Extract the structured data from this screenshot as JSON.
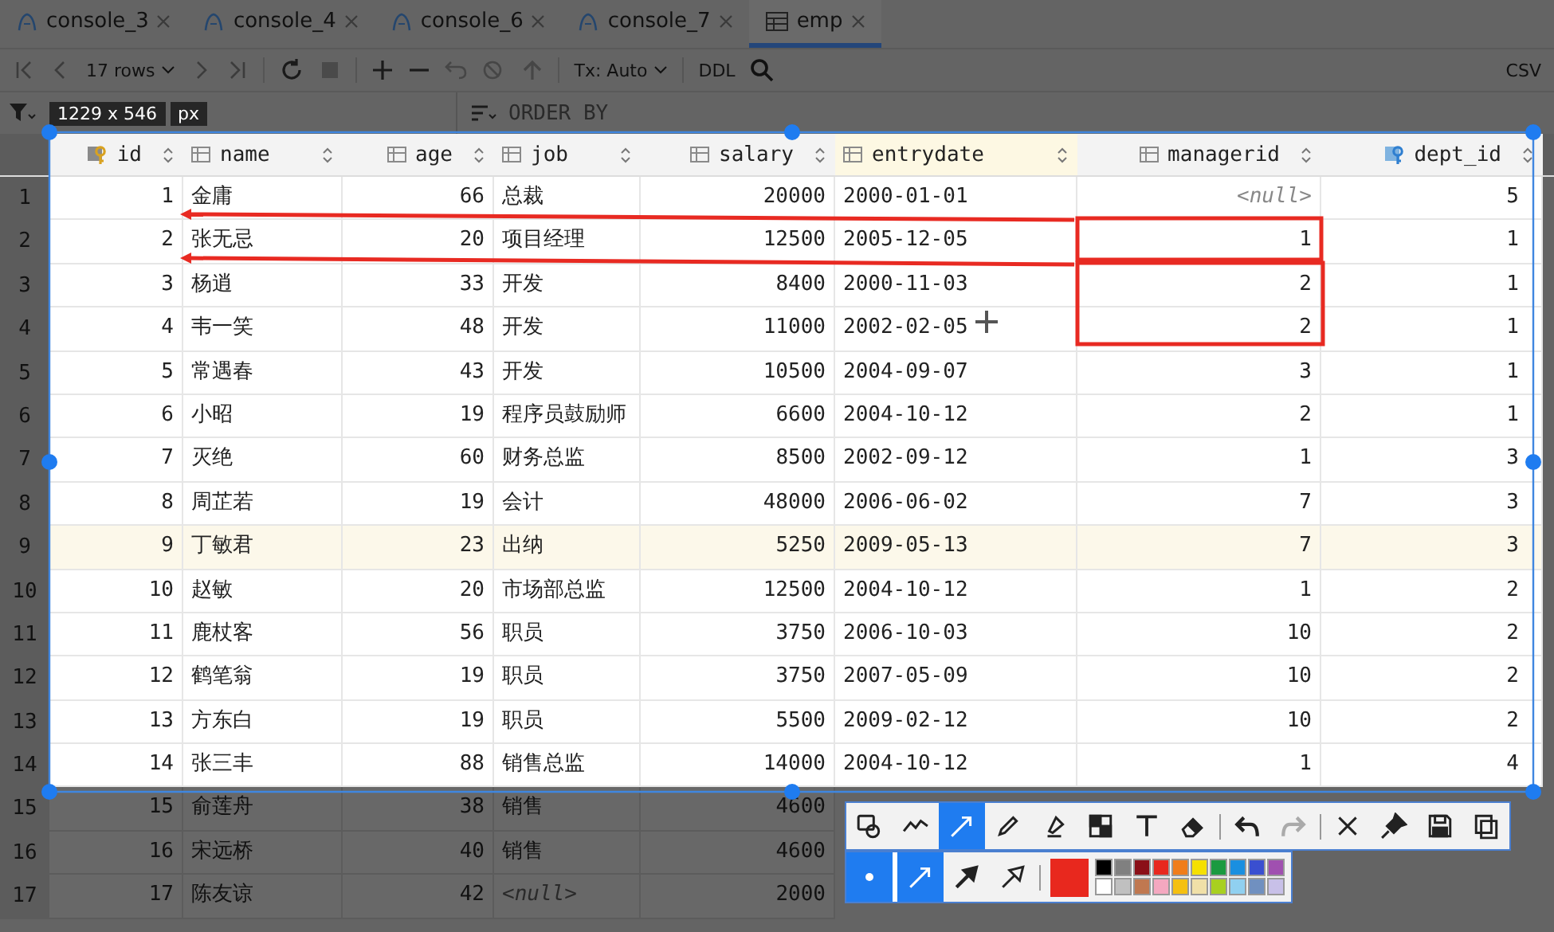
{
  "tabs": [
    {
      "label": "console_3",
      "kind": "console",
      "selected": false
    },
    {
      "label": "console_4",
      "kind": "console",
      "selected": false
    },
    {
      "label": "console_6",
      "kind": "console",
      "selected": false
    },
    {
      "label": "console_7",
      "kind": "console",
      "selected": false
    },
    {
      "label": "emp",
      "kind": "table",
      "selected": true
    }
  ],
  "toolbar": {
    "rows": "17 rows",
    "transaction": "Tx: Auto",
    "ddl": "DDL",
    "export": "CSV"
  },
  "filter_bar": {
    "placeholder": "ORDER BY"
  },
  "columns": [
    {
      "name": "id",
      "kind": "primary_key",
      "current": false
    },
    {
      "name": "name",
      "kind": "text",
      "current": false
    },
    {
      "name": "age",
      "kind": "number",
      "current": false
    },
    {
      "name": "job",
      "kind": "text",
      "current": false
    },
    {
      "name": "salary",
      "kind": "number",
      "current": false
    },
    {
      "name": "entrydate",
      "kind": "text",
      "current": true
    },
    {
      "name": "managerid",
      "kind": "number",
      "current": false
    },
    {
      "name": "dept_id",
      "kind": "foreign_key",
      "current": false
    }
  ],
  "rows": [
    {
      "number": "1",
      "selected": false,
      "cells": [
        "1",
        "金庸",
        "66",
        "总裁",
        "20000",
        "2000-01-01",
        {
          "text": "<null>",
          "kind": "null"
        },
        "5"
      ]
    },
    {
      "number": "2",
      "selected": false,
      "cells": [
        "2",
        "张无忌",
        "20",
        "项目经理",
        "12500",
        "2005-12-05",
        "1",
        "1"
      ]
    },
    {
      "number": "3",
      "selected": false,
      "cells": [
        "3",
        "杨逍",
        "33",
        "开发",
        "8400",
        "2000-11-03",
        "2",
        "1"
      ]
    },
    {
      "number": "4",
      "selected": false,
      "cells": [
        "4",
        "韦一笑",
        "48",
        "开发",
        "11000",
        "2002-02-05",
        "2",
        "1"
      ]
    },
    {
      "number": "5",
      "selected": false,
      "cells": [
        "5",
        "常遇春",
        "43",
        "开发",
        "10500",
        "2004-09-07",
        "3",
        "1"
      ]
    },
    {
      "number": "6",
      "selected": false,
      "cells": [
        "6",
        "小昭",
        "19",
        "程序员鼓励师",
        "6600",
        "2004-10-12",
        "2",
        "1"
      ]
    },
    {
      "number": "7",
      "selected": false,
      "cells": [
        "7",
        "灭绝",
        "60",
        "财务总监",
        "8500",
        "2002-09-12",
        "1",
        "3"
      ]
    },
    {
      "number": "8",
      "selected": false,
      "cells": [
        "8",
        "周芷若",
        "19",
        "会计",
        "48000",
        "2006-06-02",
        "7",
        "3"
      ]
    },
    {
      "number": "9",
      "selected": true,
      "cells": [
        "9",
        "丁敏君",
        "23",
        "出纳",
        "5250",
        "2009-05-13",
        "7",
        "3"
      ]
    },
    {
      "number": "10",
      "selected": false,
      "cells": [
        "10",
        "赵敏",
        "20",
        "市场部总监",
        "12500",
        "2004-10-12",
        "1",
        "2"
      ]
    },
    {
      "number": "11",
      "selected": false,
      "cells": [
        "11",
        "鹿杖客",
        "56",
        "职员",
        "3750",
        "2006-10-03",
        "10",
        "2"
      ]
    },
    {
      "number": "12",
      "selected": false,
      "cells": [
        "12",
        "鹤笔翁",
        "19",
        "职员",
        "3750",
        "2007-05-09",
        "10",
        "2"
      ]
    },
    {
      "number": "13",
      "selected": false,
      "cells": [
        "13",
        "方东白",
        "19",
        "职员",
        "5500",
        "2009-02-12",
        "10",
        "2"
      ]
    },
    {
      "number": "14",
      "selected": false,
      "cells": [
        "14",
        "张三丰",
        "88",
        "销售总监",
        "14000",
        "2004-10-12",
        "1",
        "4"
      ]
    },
    {
      "number": "15",
      "selected": false,
      "cells": [
        "15",
        "俞莲舟",
        "38",
        "销售",
        "4600"
      ]
    },
    {
      "number": "16",
      "selected": false,
      "cells": [
        "16",
        "宋远桥",
        "40",
        "销售",
        "4600"
      ]
    },
    {
      "number": "17",
      "selected": false,
      "cells": [
        "17",
        "陈友谅",
        "42",
        {
          "text": "<null>",
          "kind": "null"
        },
        "2000"
      ]
    }
  ],
  "capture": {
    "size": "1229 x 546",
    "unit": "px",
    "tool_groups": [
      {
        "tools": [
          {
            "kind": "shape",
            "selected": false,
            "disabled": false
          },
          {
            "kind": "curve",
            "selected": false,
            "disabled": false
          },
          {
            "kind": "arrow",
            "selected": true,
            "disabled": false
          },
          {
            "kind": "pencil",
            "selected": false,
            "disabled": false
          },
          {
            "kind": "marker",
            "selected": false,
            "disabled": false
          },
          {
            "kind": "mosaic",
            "selected": false,
            "disabled": false
          },
          {
            "kind": "text",
            "selected": false,
            "disabled": false
          },
          {
            "kind": "eraser",
            "selected": false,
            "disabled": false
          }
        ]
      },
      {
        "tools": [
          {
            "kind": "undo",
            "selected": false,
            "disabled": false
          },
          {
            "kind": "redo",
            "selected": false,
            "disabled": true
          }
        ]
      },
      {
        "tools": [
          {
            "kind": "close",
            "selected": false,
            "disabled": false
          },
          {
            "kind": "pin",
            "selected": false,
            "disabled": false
          },
          {
            "kind": "save",
            "selected": false,
            "disabled": false
          },
          {
            "kind": "copy",
            "selected": false,
            "disabled": false
          }
        ]
      }
    ],
    "option_groups": [
      {
        "options": [
          {
            "kind": "dot",
            "selected": true
          }
        ]
      },
      {
        "options": [
          {
            "kind": "arrow-line",
            "selected": true
          },
          {
            "kind": "arrow-filled",
            "selected": false
          },
          {
            "kind": "arrow-outline",
            "selected": false
          }
        ]
      }
    ],
    "current_color": {
      "color": "#e8281e"
    },
    "palette": [
      {
        "color": "#000000"
      },
      {
        "color": "#808080"
      },
      {
        "color": "#8b1018"
      },
      {
        "color": "#e8281e"
      },
      {
        "color": "#f07d1a"
      },
      {
        "color": "#f5e000"
      },
      {
        "color": "#1a9a40"
      },
      {
        "color": "#1a8fe0"
      },
      {
        "color": "#3a4fd0"
      },
      {
        "color": "#a050b0"
      },
      {
        "color": "#ffffff"
      },
      {
        "color": "#c0c0c0"
      },
      {
        "color": "#c07850"
      },
      {
        "color": "#f4a8c0"
      },
      {
        "color": "#f5c010"
      },
      {
        "color": "#f0e0a8"
      },
      {
        "color": "#a8d020"
      },
      {
        "color": "#90d0f0"
      },
      {
        "color": "#7090c0"
      },
      {
        "color": "#c8c0e8"
      }
    ]
  }
}
